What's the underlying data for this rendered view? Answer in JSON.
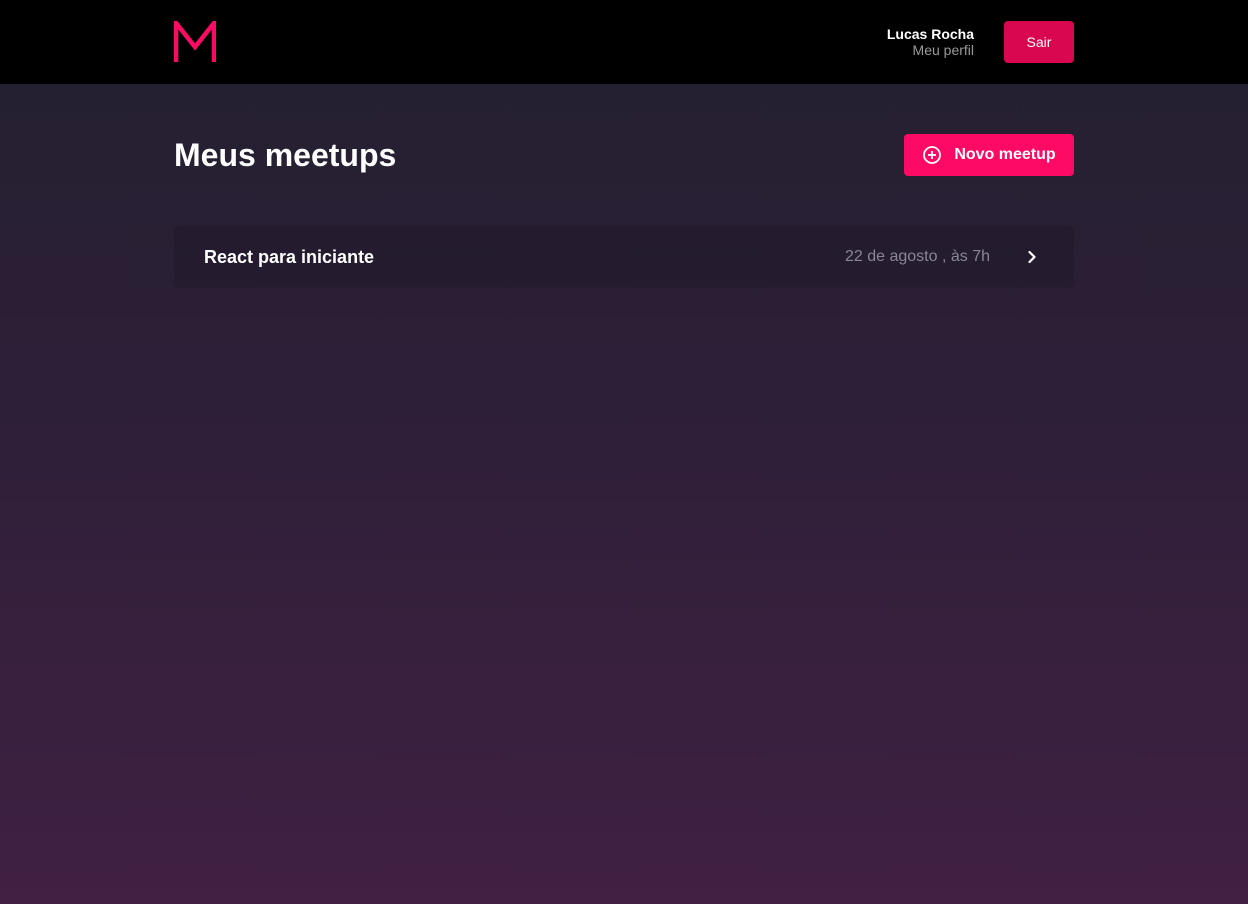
{
  "header": {
    "logo_icon": "meetup-m-logo-icon",
    "brand_color": "#fd0a64",
    "profile": {
      "name": "Lucas Rocha",
      "link_label": "Meu perfil"
    },
    "logout_label": "Sair"
  },
  "main": {
    "title": "Meus meetups",
    "new_button": {
      "icon": "add-circle-icon",
      "label": "Novo meetup"
    },
    "meetups": [
      {
        "title": "React para iniciante",
        "date": "22 de agosto , às 7h",
        "icon": "chevron-right-icon"
      }
    ]
  }
}
